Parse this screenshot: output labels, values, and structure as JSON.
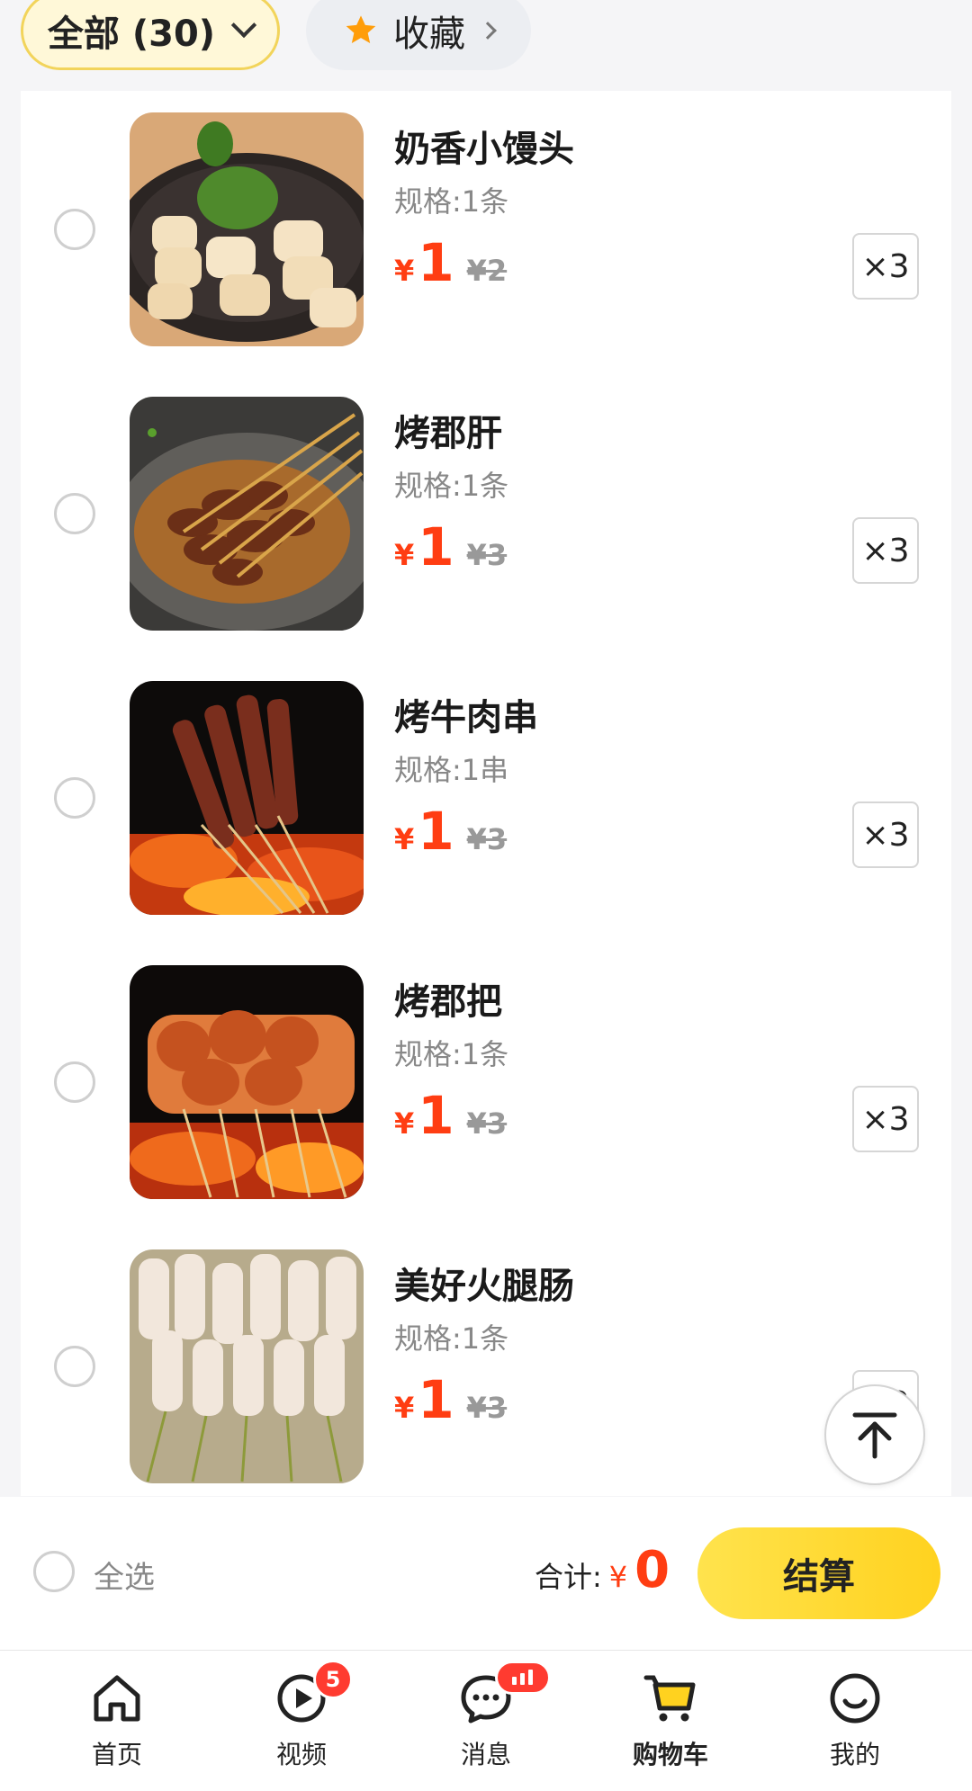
{
  "filters": {
    "all_label": "全部 (30)",
    "favorites_label": "收藏"
  },
  "items": [
    {
      "name": "奶香小馒头",
      "spec": "规格:1条",
      "currency": "¥",
      "price": "1",
      "original_price": "¥2",
      "quantity": "×3"
    },
    {
      "name": "烤郡肝",
      "spec": "规格:1条",
      "currency": "¥",
      "price": "1",
      "original_price": "¥3",
      "quantity": "×3"
    },
    {
      "name": "烤牛肉串",
      "spec": "规格:1串",
      "currency": "¥",
      "price": "1",
      "original_price": "¥3",
      "quantity": "×3"
    },
    {
      "name": "烤郡把",
      "spec": "规格:1条",
      "currency": "¥",
      "price": "1",
      "original_price": "¥3",
      "quantity": "×3"
    },
    {
      "name": "美好火腿肠",
      "spec": "规格:1条",
      "currency": "¥",
      "price": "1",
      "original_price": "¥3",
      "quantity": "×3"
    }
  ],
  "checkout": {
    "select_all_label": "全选",
    "total_label": "合计:",
    "currency": "¥",
    "total_amount": "0",
    "pay_label": "结算"
  },
  "tabbar": {
    "home": "首页",
    "video": "视频",
    "video_badge": "5",
    "messages": "消息",
    "cart": "购物车",
    "profile": "我的"
  },
  "colors": {
    "accent_yellow": "#ffd21f",
    "price_red": "#ff3d12",
    "badge_red": "#ff3b30"
  },
  "icons": [
    "chevron-down-icon",
    "star-icon",
    "chevron-right-icon",
    "back-to-top-icon",
    "home-icon",
    "video-play-icon",
    "message-icon",
    "cart-icon",
    "profile-smile-icon"
  ]
}
